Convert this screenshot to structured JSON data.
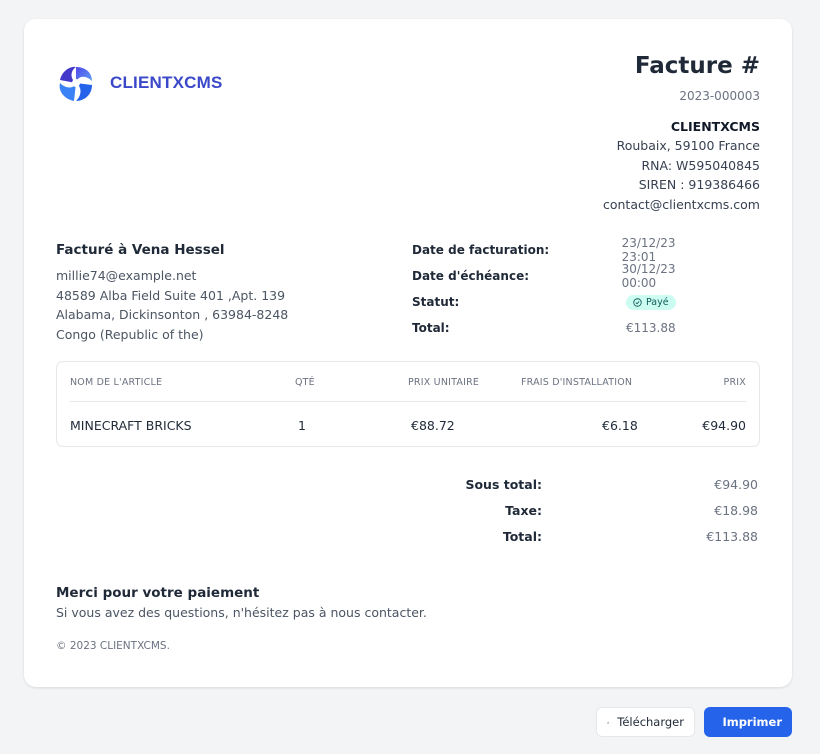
{
  "brand": {
    "name": "CLIENTXCMS",
    "logo_icon": "swirl-logo-icon"
  },
  "invoice": {
    "title": "Facture #",
    "number": "2023-000003"
  },
  "company": {
    "name": "CLIENTXCMS",
    "address": "Roubaix, 59100 France",
    "rna": "RNA: W595040845",
    "siren": "SIREN : 919386466",
    "email": "contact@clientxcms.com"
  },
  "bill_to": {
    "title": "Facturé à Vena Hessel",
    "email": "millie74@example.net",
    "line1": "48589 Alba Field Suite 401 ,Apt. 139",
    "line2": "Alabama, Dickinsonton , 63984-8248",
    "line3": "Congo (Republic of the)"
  },
  "meta": {
    "date_label": "Date de facturation:",
    "date_value": "23/12/23 23:01",
    "due_label": "Date d'échéance:",
    "due_value": "30/12/23 00:00",
    "status_label": "Statut:",
    "status_value": "Payé",
    "total_label": "Total:",
    "total_value": "€113.88"
  },
  "table": {
    "headers": [
      "NOM DE L'ARTICLE",
      "QTÉ",
      "PRIX UNITAIRE",
      "FRAIS D'INSTALLATION",
      "PRIX"
    ],
    "rows": [
      [
        "MINECRAFT BRICKS",
        "1",
        "€88.72",
        "€6.18",
        "€94.90"
      ]
    ]
  },
  "totals": {
    "subtotal_label": "Sous total:",
    "subtotal_value": "€94.90",
    "tax_label": "Taxe:",
    "tax_value": "€18.98",
    "total_label": "Total:",
    "total_value": "€113.88"
  },
  "footer": {
    "thanks_title": "Merci pour votre paiement",
    "thanks_text": "Si vous avez des questions, n'hésitez pas à nous contacter.",
    "copyright": "© 2023 CLIENTXCMS."
  },
  "actions": {
    "download_label": "Télécharger",
    "print_label": "Imprimer"
  },
  "colors": {
    "brand": "#3b49c9",
    "primary": "#2563eb",
    "badge_bg": "#ccfbf1",
    "badge_text": "#115e59"
  }
}
